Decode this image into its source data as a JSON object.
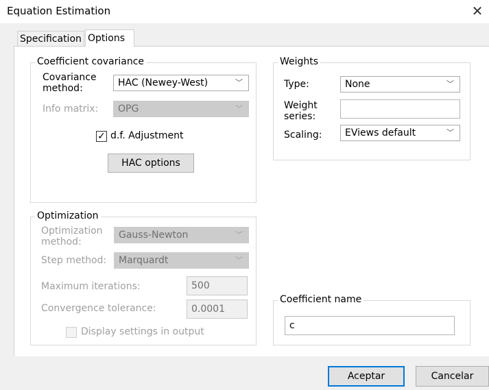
{
  "window": {
    "title": "Equation Estimation",
    "close_glyph": "✕"
  },
  "tabs": [
    {
      "label": "Specification",
      "active": false
    },
    {
      "label": "Options",
      "active": true
    }
  ],
  "coef_cov": {
    "legend": "Coefficient covariance",
    "cov_method_label_1": "Covariance",
    "cov_method_label_2": "method:",
    "cov_method_value": "HAC (Newey-West)",
    "info_matrix_label": "Info matrix:",
    "info_matrix_value": "OPG",
    "df_adjust_label": "d.f. Adjustment",
    "df_adjust_checked": true,
    "hac_options_label": "HAC options"
  },
  "optimization": {
    "legend": "Optimization",
    "opt_method_label_1": "Optimization",
    "opt_method_label_2": "method:",
    "opt_method_value": "Gauss-Newton",
    "step_method_label": "Step method:",
    "step_method_value": "Marquardt",
    "max_iter_label": "Maximum iterations:",
    "max_iter_value": "500",
    "conv_tol_label": "Convergence tolerance:",
    "conv_tol_value": "0.0001",
    "display_settings_label": "Display settings in output",
    "display_settings_checked": false
  },
  "weights": {
    "legend": "Weights",
    "type_label": "Type:",
    "type_value": "None",
    "weight_series_label_1": "Weight",
    "weight_series_label_2": "series:",
    "weight_series_value": "",
    "scaling_label": "Scaling:",
    "scaling_value": "EViews default"
  },
  "coef_name": {
    "legend": "Coefficient name",
    "value": "c"
  },
  "buttons": {
    "ok": "Aceptar",
    "cancel": "Cancelar"
  },
  "icons": {
    "chevron": "﹀",
    "check": "✓"
  }
}
